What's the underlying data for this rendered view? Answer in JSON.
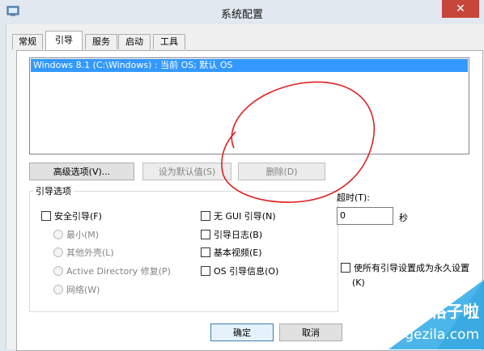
{
  "window": {
    "title": "系统配置",
    "close_glyph": "✕"
  },
  "tabs": [
    {
      "label": "常规"
    },
    {
      "label": "引导"
    },
    {
      "label": "服务"
    },
    {
      "label": "启动"
    },
    {
      "label": "工具"
    }
  ],
  "os_list": {
    "entries": [
      "Windows 8.1 (C:\\Windows) : 当前 OS; 默认 OS"
    ]
  },
  "buttons": {
    "advanced": "高级选项(V)...",
    "set_default": "设为默认值(S)",
    "delete": "删除(D)",
    "ok": "确定",
    "cancel": "取消"
  },
  "boot_options": {
    "group_title": "引导选项",
    "safe_boot": "安全引导(F)",
    "minimal": "最小(M)",
    "alternate_shell": "其他外壳(L)",
    "ad_repair": "Active Directory 修复(P)",
    "network": "网络(W)",
    "no_gui": "无 GUI 引导(N)",
    "boot_log": "引导日志(B)",
    "base_video": "基本视频(E)",
    "os_boot_info": "OS 引导信息(O)"
  },
  "timeout": {
    "label": "超时(T):",
    "value": "0",
    "unit": "秒"
  },
  "permanent": {
    "label_line1": "使所有引导设置成为永久设置",
    "label_line2": "(K)"
  },
  "watermark": {
    "text_cn": "格子啦",
    "text_en": "gezila.com"
  },
  "colors": {
    "selection": "#3399ff",
    "close": "#c7463a",
    "annotation": "#e02020",
    "watermark": "#2aa3e0"
  }
}
